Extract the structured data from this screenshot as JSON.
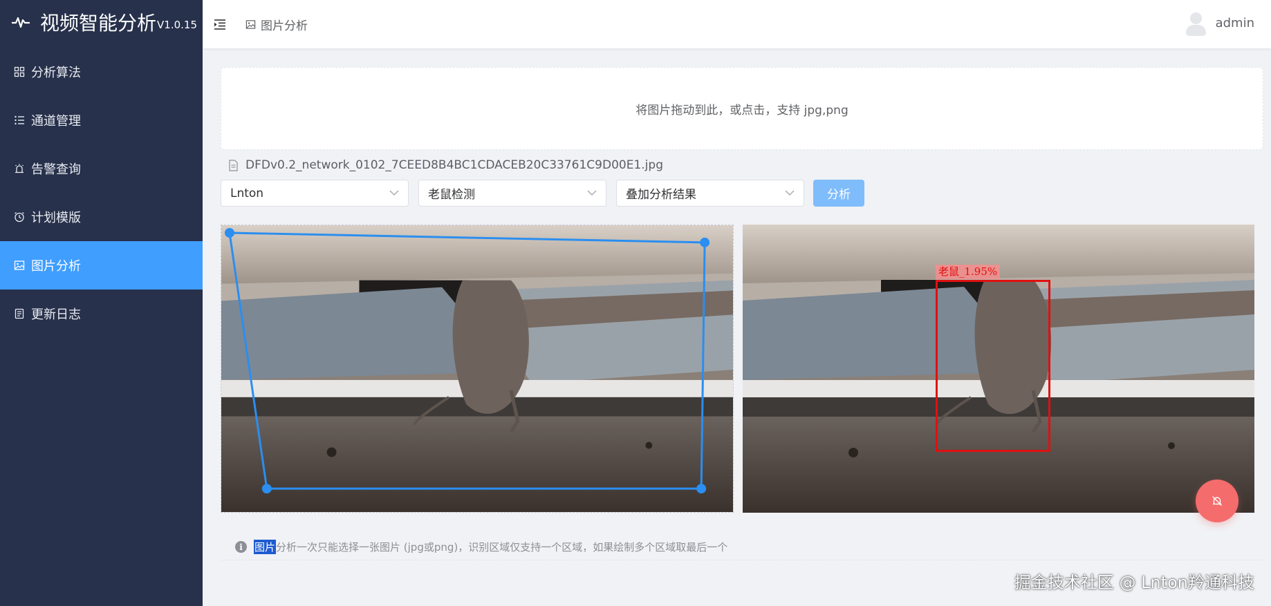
{
  "app": {
    "title": "视频智能分析",
    "version": "V1.0.15"
  },
  "sidebar": {
    "items": [
      {
        "label": "分析算法",
        "icon": "grid-icon",
        "active": false
      },
      {
        "label": "通道管理",
        "icon": "list-icon",
        "active": false
      },
      {
        "label": "告警查询",
        "icon": "alarm-icon",
        "active": false
      },
      {
        "label": "计划模版",
        "icon": "clock-icon",
        "active": false
      },
      {
        "label": "图片分析",
        "icon": "picture-icon",
        "active": true
      },
      {
        "label": "更新日志",
        "icon": "document-icon",
        "active": false
      }
    ]
  },
  "header": {
    "breadcrumb": "图片分析",
    "username": "admin"
  },
  "upload": {
    "hint": "将图片拖动到此，或点击，支持 jpg,png"
  },
  "file": {
    "name": "DFDv0.2_network_0102_7CEED8B4BC1CDACEB20C33761C9D00E1.jpg"
  },
  "controls": {
    "channel": "Lnton",
    "algorithm": "老鼠检测",
    "result_mode": "叠加分析结果",
    "analyze_label": "分析"
  },
  "result": {
    "detection_label": "老鼠_1.95%"
  },
  "tip": {
    "highlight": "图片",
    "text": "分析一次只能选择一张图片 (jpg或png)，识别区域仅支持一个区域，如果绘制多个区域取最后一个"
  },
  "watermark": "掘金技术社区 @ Lnton羚通科技",
  "colors": {
    "sidebar": "#27314b",
    "accent": "#409eff",
    "detect": "#e11010",
    "fab": "#f56c6c"
  }
}
